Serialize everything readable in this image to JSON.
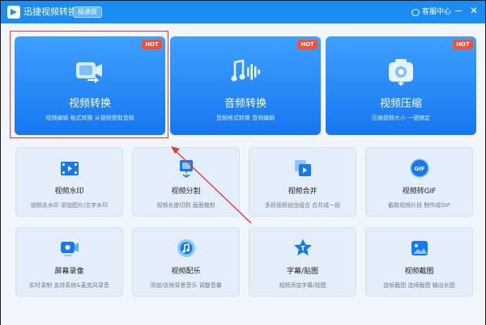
{
  "titlebar": {
    "app_title": "迅捷视频转换器",
    "edition": "极速版",
    "support": "客服中心"
  },
  "feature_cards": [
    {
      "title": "视频转换",
      "subtitle": "视频编辑 格式转换 从视频提取音频",
      "badge": "HOT",
      "icon": "video-convert-icon"
    },
    {
      "title": "音频转换",
      "subtitle": "音频格式转换 音频编辑",
      "badge": "HOT",
      "icon": "audio-wave-icon"
    },
    {
      "title": "视频压缩",
      "subtitle": "压缩视频大小 一键搞定",
      "badge": "HOT",
      "icon": "camera-compress-icon"
    }
  ],
  "tools": [
    {
      "title": "视频水印",
      "subtitle": "视频去水印 添加图片/文字水印",
      "icon": "film-icon"
    },
    {
      "title": "视频分割",
      "subtitle": "视频长度切割 画面裁剪",
      "icon": "split-icon"
    },
    {
      "title": "视频合并",
      "subtitle": "多段视频自由组合 合并成一段",
      "icon": "merge-icon"
    },
    {
      "title": "视频转GIF",
      "subtitle": "截取视频片段 制作成GIF",
      "icon": "gif-icon"
    },
    {
      "title": "屏幕录像",
      "subtitle": "实时录制 支持系统&麦克风录音",
      "icon": "screen-record-icon"
    },
    {
      "title": "视频配乐",
      "subtitle": "添加/去除背景音乐 调整音量",
      "icon": "music-icon"
    },
    {
      "title": "字幕/贴图",
      "subtitle": "视频添加字幕/贴图",
      "icon": "subtitle-icon"
    },
    {
      "title": "视频截图",
      "subtitle": "连帧截图 连续截图 输出长图",
      "icon": "screenshot-icon"
    }
  ],
  "colors": {
    "titlebar": "#1b8cf0",
    "card": "#1677f0",
    "hot": "#ff4d2d",
    "annotation": "#e53935"
  }
}
